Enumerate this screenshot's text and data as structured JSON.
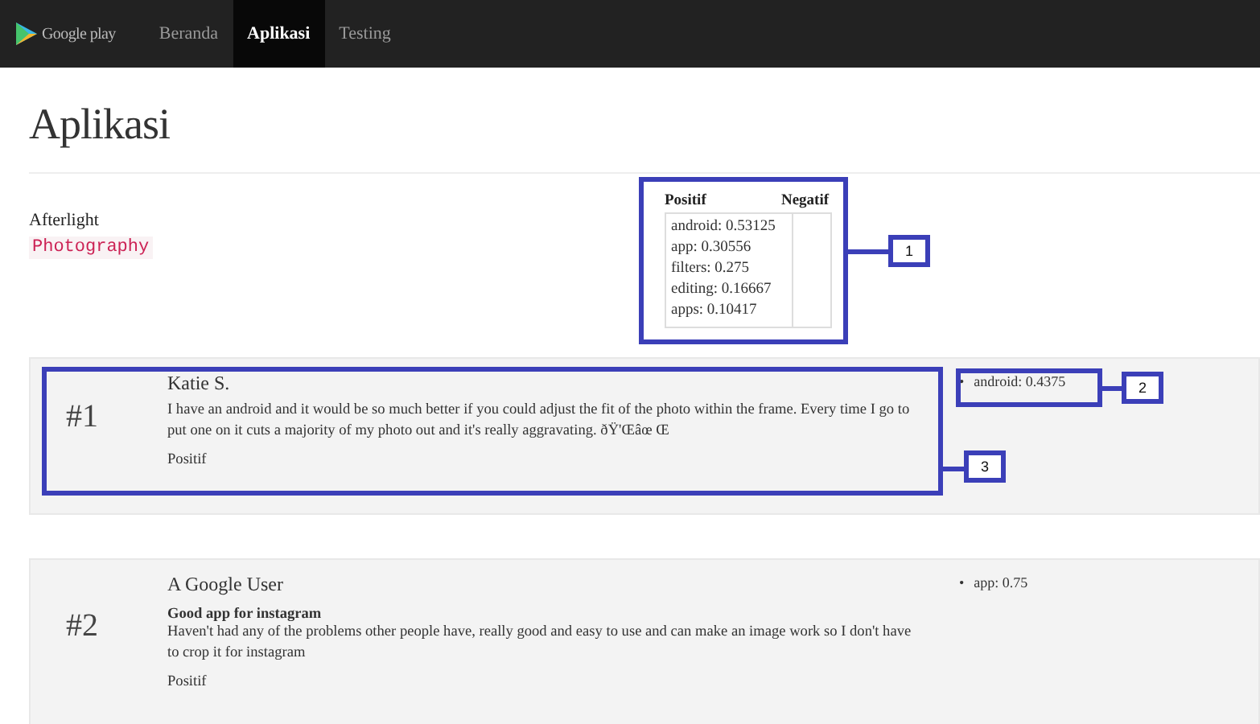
{
  "navbar": {
    "brand": "Google play",
    "items": [
      {
        "label": "Beranda",
        "selected": false
      },
      {
        "label": "Aplikasi",
        "selected": true
      },
      {
        "label": "Testing",
        "selected": false
      }
    ]
  },
  "page_title": "Aplikasi",
  "app": {
    "name": "Afterlight",
    "category": "Photography"
  },
  "sentiment_table": {
    "columns": [
      "Positif",
      "Negatif"
    ],
    "positive": [
      "android: 0.53125",
      "app: 0.30556",
      "filters: 0.275",
      "editing: 0.16667",
      "apps: 0.10417"
    ]
  },
  "reviews": [
    {
      "rank": "#1",
      "author": "Katie S.",
      "text": "I have an android and it would be so much better if you could adjust the fit of the photo within the frame. Every time I go to put one on it cuts a majority of my photo out and it's really aggravating. ðŸ'Œâœ Œ",
      "sentiment": "Positif",
      "keyword_bullet": "•",
      "keywords": [
        "android: 0.4375"
      ]
    },
    {
      "rank": "#2",
      "author": "A Google User",
      "title": "Good app for instagram",
      "text": "Haven't had any of the problems other people have, really good and easy to use and can make an image work so I don't have to crop it for instagram",
      "sentiment": "Positif",
      "keyword_bullet": "•",
      "keywords": [
        "app: 0.75"
      ]
    }
  ],
  "annotations": [
    "1",
    "2",
    "3"
  ]
}
